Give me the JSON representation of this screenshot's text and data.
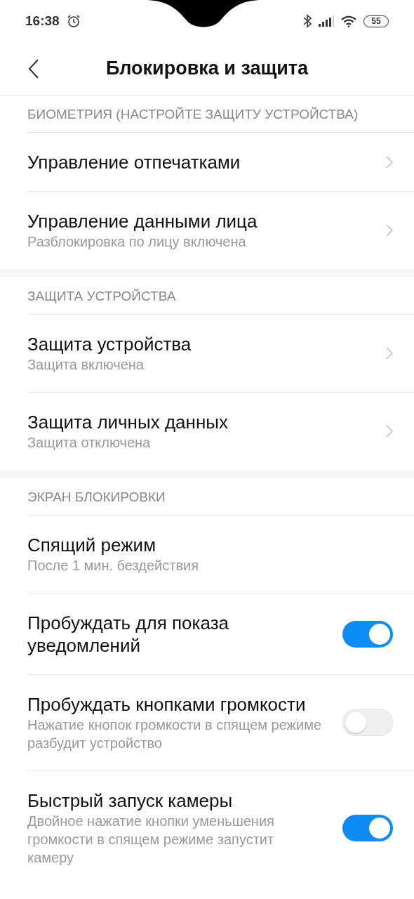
{
  "status_bar": {
    "time": "16:38",
    "battery": "55"
  },
  "header": {
    "title": "Блокировка и защита"
  },
  "sections": [
    {
      "title": "БИОМЕТРИЯ (НАСТРОЙТЕ ЗАЩИТУ УСТРОЙСТВА)",
      "items": [
        {
          "kind": "link",
          "title": "Управление отпечатками"
        },
        {
          "kind": "link",
          "title": "Управление данными лица",
          "subtitle": "Разблокировка по лицу включена"
        }
      ]
    },
    {
      "title": "ЗАЩИТА УСТРОЙСТВА",
      "items": [
        {
          "kind": "link",
          "title": "Защита устройства",
          "subtitle": "Защита включена"
        },
        {
          "kind": "link",
          "title": "Защита личных данных",
          "subtitle": "Защита отключена"
        }
      ]
    },
    {
      "title": "ЭКРАН БЛОКИРОВКИ",
      "items": [
        {
          "kind": "plain",
          "title": "Спящий режим",
          "subtitle": "После 1 мин. бездействия"
        },
        {
          "kind": "toggle",
          "title": "Пробуждать для показа уведомлений",
          "on": true
        },
        {
          "kind": "toggle",
          "title": "Пробуждать кнопками громкости",
          "subtitle": "Нажатие кнопок громкости в спящем режиме разбудит устройство",
          "on": false
        },
        {
          "kind": "toggle",
          "title": "Быстрый запуск камеры",
          "subtitle": "Двойное нажатие кнопки уменьшения громкости в спящем режиме запустит камеру",
          "on": true
        }
      ]
    }
  ]
}
